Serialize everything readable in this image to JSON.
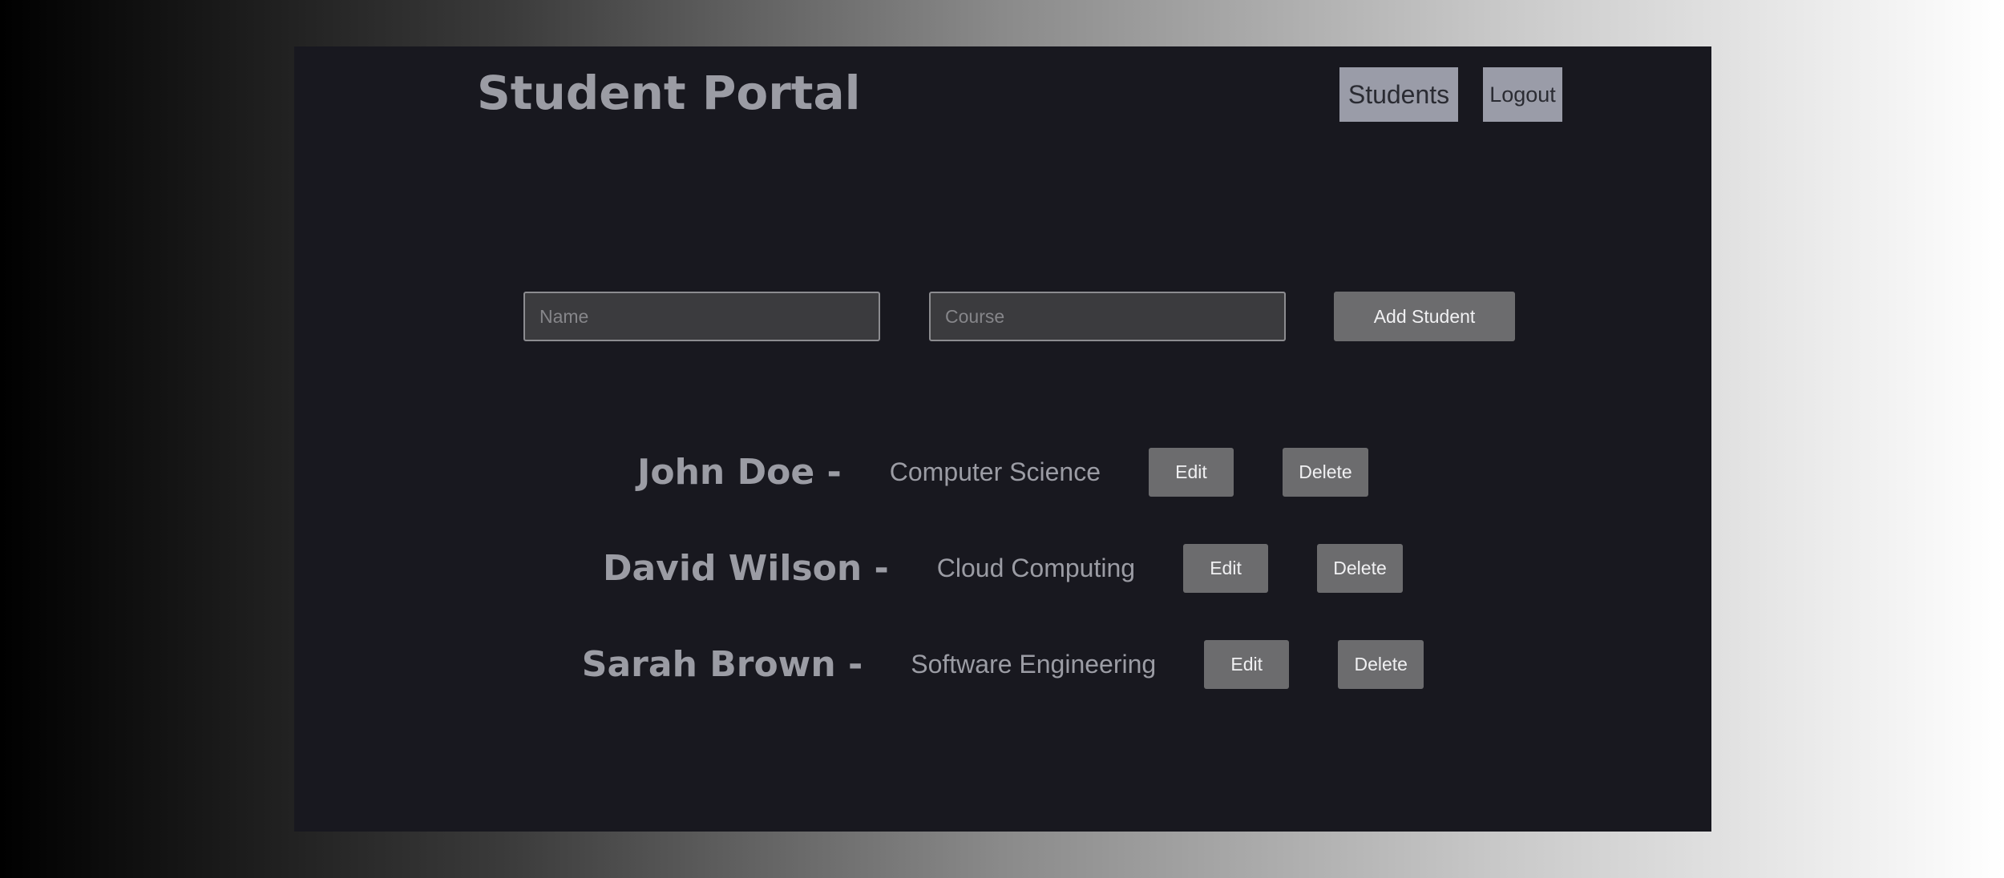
{
  "header": {
    "title": "Student Portal",
    "nav": {
      "students_label": "Students",
      "logout_label": "Logout"
    }
  },
  "form": {
    "name_placeholder": "Name",
    "name_value": "",
    "course_placeholder": "Course",
    "course_value": "",
    "add_label": "Add Student"
  },
  "students": [
    {
      "name": "John Doe -",
      "course": "Computer Science",
      "edit_label": "Edit",
      "delete_label": "Delete"
    },
    {
      "name": "David Wilson -",
      "course": "Cloud Computing",
      "edit_label": "Edit",
      "delete_label": "Delete"
    },
    {
      "name": "Sarah Brown -",
      "course": "Software Engineering",
      "edit_label": "Edit",
      "delete_label": "Delete"
    }
  ],
  "colors": {
    "panel_background": "#18181f",
    "text_muted": "#9b9ca4",
    "nav_button": "#9a9ca8",
    "action_button": "#6c6c6e",
    "input_background": "#3b3b3e"
  }
}
